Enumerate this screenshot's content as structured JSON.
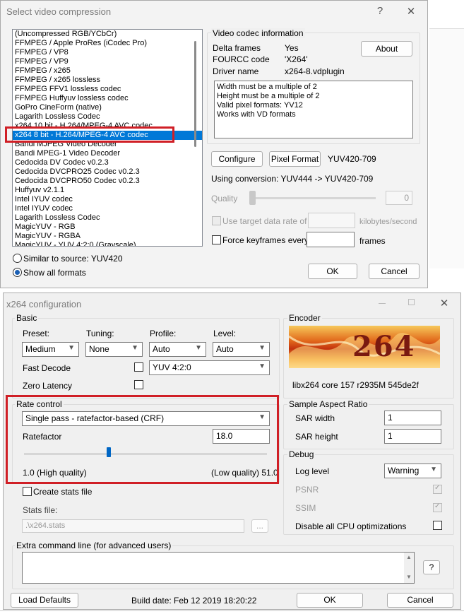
{
  "compression_dialog": {
    "title": "Select video compression",
    "help_glyph": "?",
    "close_glyph": "✕",
    "codecs": [
      "(Uncompressed RGB/YCbCr)",
      "FFMPEG / Apple ProRes (iCodec Pro)",
      "FFMPEG / VP8",
      "FFMPEG / VP9",
      "FFMPEG / x265",
      "FFMPEG / x265 lossless",
      "FFMPEG FFV1 lossless codec",
      "FFMPEG Huffyuv lossless codec",
      "GoPro CineForm (native)",
      "Lagarith Lossless Codec",
      "x264 10 bit - H.264/MPEG-4 AVC codec",
      "x264 8 bit - H.264/MPEG-4 AVC codec",
      "Bandi MJPEG Video Decoder",
      "Bandi MPEG-1 Video Decoder",
      "Cedocida DV Codec v0.2.3",
      "Cedocida DVCPRO25 Codec v0.2.3",
      "Cedocida DVCPRO50 Codec v0.2.3",
      "Huffyuv v2.1.1",
      "Intel IYUV codec",
      "Intel IYUV codec",
      "Lagarith Lossless Codec",
      "MagicYUV - RGB",
      "MagicYUV - RGBA",
      "MagicYUV - YUV 4:2:0 (Grayscale)"
    ],
    "selected_index": 11,
    "codec_info": {
      "group_label": "Video codec information",
      "rows": [
        {
          "label": "Delta frames",
          "value": "Yes"
        },
        {
          "label": "FOURCC code",
          "value": "'X264'"
        },
        {
          "label": "Driver name",
          "value": "x264-8.vdplugin"
        }
      ],
      "about_label": "About",
      "notes": [
        "Width must be a multiple of 2",
        "Height must be a multiple of 2",
        "Valid pixel formats: YV12",
        "Works with VD formats"
      ]
    },
    "configure_label": "Configure",
    "pixel_format_label": "Pixel Format",
    "pixel_format_value": "YUV420-709",
    "conversion_text": "Using conversion: YUV444 -> YUV420-709",
    "quality_label": "Quality",
    "quality_value": "0",
    "target_rate_label": "Use target data rate of",
    "target_rate_unit": "kilobytes/second",
    "keyframes_label": "Force keyframes every",
    "keyframes_unit": "frames",
    "similar_source_label": "Similar to source: YUV420",
    "show_all_label": "Show all formats",
    "ok_label": "OK",
    "cancel_label": "Cancel"
  },
  "x264_dialog": {
    "title": "x264 configuration",
    "close_glyph": "✕",
    "basic": {
      "group_label": "Basic",
      "preset_label": "Preset:",
      "preset_value": "Medium",
      "tuning_label": "Tuning:",
      "tuning_value": "None",
      "profile_label": "Profile:",
      "profile_value": "Auto",
      "level_label": "Level:",
      "level_value": "Auto",
      "fast_decode_label": "Fast Decode",
      "zero_latency_label": "Zero Latency",
      "chroma_value": "YUV 4:2:0"
    },
    "encoder": {
      "group_label": "Encoder",
      "logo_text": "264",
      "version_text": "libx264 core 157 r2935M 545de2f"
    },
    "rate_control": {
      "group_label": "Rate control",
      "mode_value": "Single pass - ratefactor-based (CRF)",
      "ratefactor_label": "Ratefactor",
      "ratefactor_value": "18.0",
      "slider_fraction": 0.35,
      "min_label": "1.0 (High quality)",
      "max_label": "(Low quality) 51.0",
      "stats_file_check_label": "Create stats file",
      "stats_file_label": "Stats file:",
      "stats_file_value": ".\\x264.stats",
      "browse_label": "..."
    },
    "sar": {
      "group_label": "Sample Aspect Ratio",
      "width_label": "SAR width",
      "width_value": "1",
      "height_label": "SAR height",
      "height_value": "1"
    },
    "debug": {
      "group_label": "Debug",
      "log_level_label": "Log level",
      "log_level_value": "Warning",
      "psnr_label": "PSNR",
      "ssim_label": "SSIM",
      "disable_cpu_label": "Disable all CPU optimizations"
    },
    "extra": {
      "group_label": "Extra command line (for advanced users)",
      "help_label": "?"
    },
    "load_defaults_label": "Load Defaults",
    "build_date": "Build date: Feb 12 2019 18:20:22",
    "ok_label": "OK",
    "cancel_label": "Cancel"
  },
  "colors": {
    "highlight_red": "#d01f26",
    "selection_blue": "#0078d7"
  }
}
